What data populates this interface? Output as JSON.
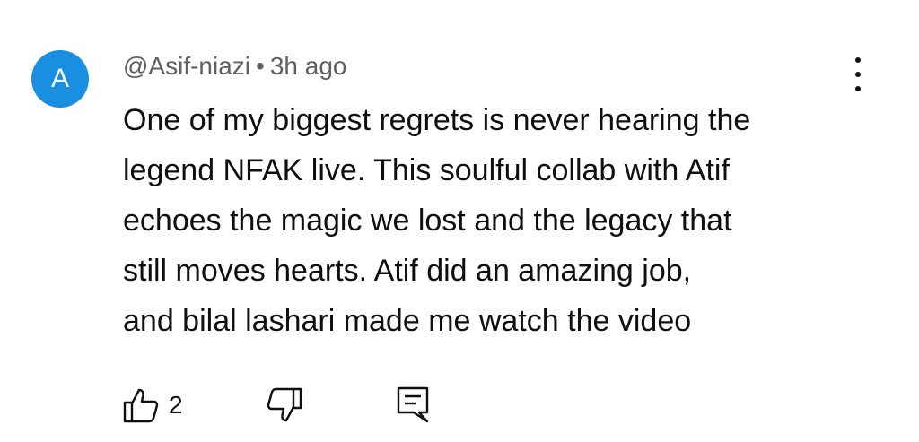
{
  "comment": {
    "avatar_letter": "A",
    "avatar_color": "#1a8ee0",
    "author": "@Asif-niazi",
    "separator": "•",
    "time": "3h ago",
    "text_lines": [
      "One of my biggest regrets is never hearing the",
      "legend NFAK live. This soulful collab with Atif",
      "echoes the magic we lost and the legacy that",
      "still moves hearts. Atif did an amazing job,",
      "and bilal lashari made me watch the video"
    ],
    "like_count": "2",
    "icons": {
      "more": "more-vertical-icon",
      "like": "thumbs-up-icon",
      "dislike": "thumbs-down-icon",
      "reply": "reply-comment-icon"
    }
  }
}
